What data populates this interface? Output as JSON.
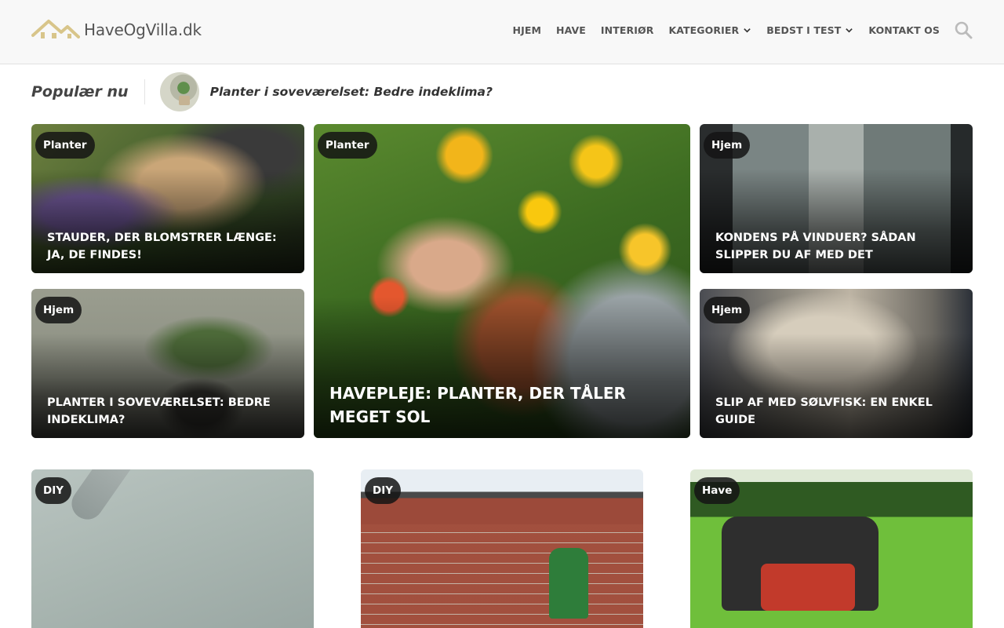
{
  "header": {
    "logo_text": "HaveOgVilla.dk",
    "nav": [
      {
        "label": "HJEM",
        "has_dropdown": false
      },
      {
        "label": "HAVE",
        "has_dropdown": false
      },
      {
        "label": "INTERIØR",
        "has_dropdown": false
      },
      {
        "label": "KATEGORIER",
        "has_dropdown": true
      },
      {
        "label": "BEDST I TEST",
        "has_dropdown": true
      },
      {
        "label": "KONTAKT OS",
        "has_dropdown": false
      }
    ],
    "search_icon": "search-icon"
  },
  "popular": {
    "label": "Populær nu",
    "title": "Planter i soveværelset: Bedre indeklima?"
  },
  "featured": [
    {
      "category": "Planter",
      "title": "Stauder, der blomstrer længe: ja, de findes!"
    },
    {
      "category": "Planter",
      "title": "Havepleje: Planter, der tåler meget sol"
    },
    {
      "category": "Hjem",
      "title": "Kondens på vinduer? Sådan slipper du af med det"
    },
    {
      "category": "Hjem",
      "title": "Planter i soveværelset: Bedre indeklima?"
    },
    {
      "category": "Hjem",
      "title": "Slip af med sølvfisk: En enkel guide"
    }
  ],
  "grid": [
    {
      "category": "DIY"
    },
    {
      "category": "DIY"
    },
    {
      "category": "Have"
    }
  ],
  "colors": {
    "header_bg": "#f8f8f8",
    "nav_text": "#555555",
    "badge_bg": "#141414",
    "logo_accent": "#d8c58a"
  }
}
